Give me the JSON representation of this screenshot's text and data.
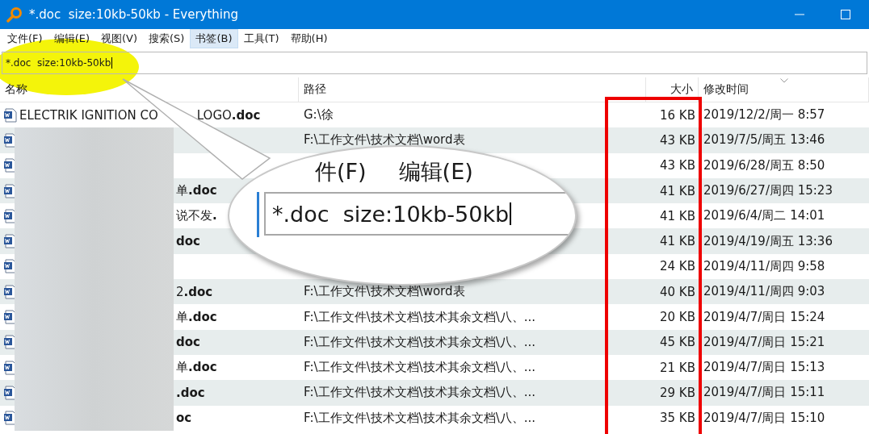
{
  "window": {
    "title": "*.doc  size:10kb-50kb - Everything"
  },
  "menu": [
    {
      "label": "文件(F)",
      "selected": false
    },
    {
      "label": "编辑(E)",
      "selected": false
    },
    {
      "label": "视图(V)",
      "selected": false
    },
    {
      "label": "搜索(S)",
      "selected": false
    },
    {
      "label": "书签(B)",
      "selected": true
    },
    {
      "label": "工具(T)",
      "selected": false
    },
    {
      "label": "帮助(H)",
      "selected": false
    }
  ],
  "search": {
    "value": "*.doc  size:10kb-50kb"
  },
  "table": {
    "columns": [
      "名称",
      "路径",
      "大小",
      "修改时间"
    ],
    "rows": [
      {
        "name": "ELECTRIK IGNITION CO",
        "name_after_gap": "LOGO**.doc**",
        "blurred": false,
        "path": "G:\\徐",
        "size": "16 KB",
        "modified": "2019/12/2/周一 8:57"
      },
      {
        "blurred": true,
        "path": "F:\\工作文件\\技术文档\\word表",
        "size": "43 KB",
        "modified": "2019/7/5/周五 13:46"
      },
      {
        "blurred": true,
        "size": "43 KB",
        "modified": "2019/6/28/周五 8:50"
      },
      {
        "name": "单**.doc**",
        "blurred": true,
        "size": "41 KB",
        "modified": "2019/6/27/周四 15:23"
      },
      {
        "name": "说不发**.**",
        "blurred": true,
        "size": "41 KB",
        "modified": "2019/6/4/周二 14:01"
      },
      {
        "name": "**doc**",
        "blurred": true,
        "size": "41 KB",
        "modified": "2019/4/19/周五 13:36"
      },
      {
        "blurred": true,
        "size": "24 KB",
        "modified": "2019/4/11/周四 9:58"
      },
      {
        "name": " 2**.doc**",
        "blurred": true,
        "path": "F:\\工作文件\\技术文档\\word表",
        "size": "40 KB",
        "modified": "2019/4/11/周四 9:03"
      },
      {
        "name": "单**.doc**",
        "blurred": true,
        "path": "F:\\工作文件\\技术文档\\技术其余文档\\八、...",
        "size": "20 KB",
        "modified": "2019/4/7/周日 15:24"
      },
      {
        "name": "**doc**",
        "blurred": true,
        "path": "F:\\工作文件\\技术文档\\技术其余文档\\八、...",
        "size": "45 KB",
        "modified": "2019/4/7/周日 15:21"
      },
      {
        "name": "单**.doc**",
        "blurred": true,
        "path": "F:\\工作文件\\技术文档\\技术其余文档\\八、...",
        "size": "21 KB",
        "modified": "2019/4/7/周日 15:13"
      },
      {
        "name": "**.doc**",
        "blurred": true,
        "path": "F:\\工作文件\\技术文档\\技术其余文档\\八、...",
        "size": "29 KB",
        "modified": "2019/4/7/周日 15:11"
      },
      {
        "name": "**oc**",
        "blurred": true,
        "path": "F:\\工作文件\\技术文档\\技术其余文档\\八、...",
        "size": "35 KB",
        "modified": "2019/4/7/周日 15:10"
      }
    ]
  },
  "callout": {
    "menu": [
      "件(F)",
      "编辑(E)"
    ],
    "search_value": "*.doc  size:10kb-50kb"
  }
}
